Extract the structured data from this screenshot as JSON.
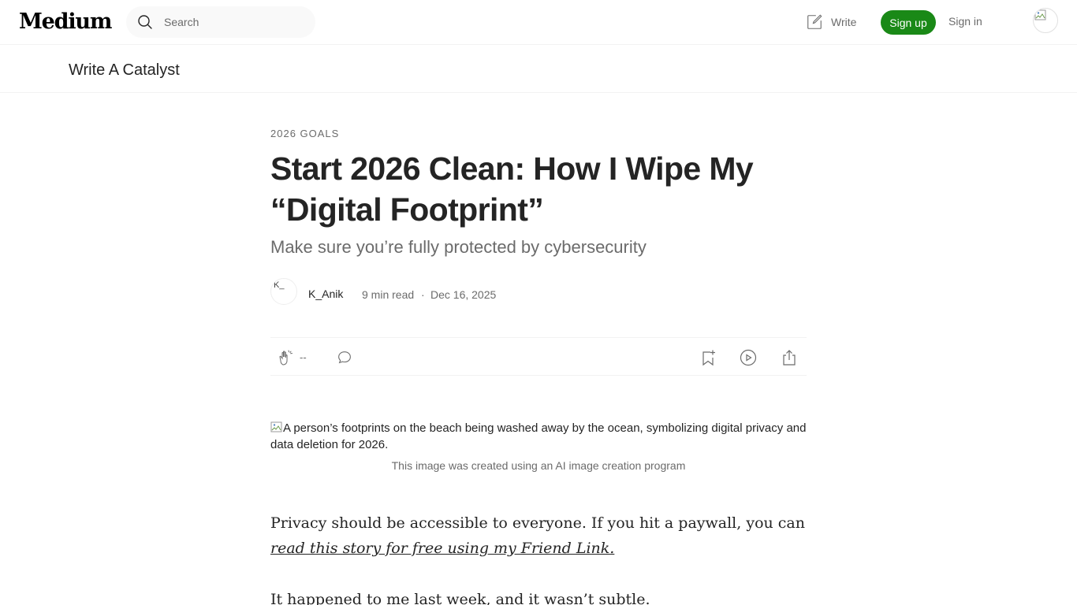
{
  "header": {
    "logo": "Medium",
    "search_placeholder": "Search",
    "write_label": "Write",
    "signup_label": "Sign up",
    "signin_label": "Sign in"
  },
  "publication": {
    "name": "Write A Catalyst"
  },
  "article": {
    "kicker": "2026 GOALS",
    "title": "Start 2026 Clean: How I Wipe My “Digital Footprint”",
    "subtitle": "Make sure you’re fully protected by cybersecurity",
    "author": {
      "name": "K_Anik",
      "avatar_alt": "K_"
    },
    "read_time": "9 min read",
    "separator": "·",
    "date": "Dec 16, 2025",
    "clap_count": "--",
    "image": {
      "alt": "A person’s footprints on the beach being washed away by the ocean, symbolizing digital privacy and data deletion for 2026.",
      "caption": "This image was created using an AI image creation program"
    },
    "paragraph_1": {
      "text": "Privacy should be accessible to everyone. If you hit a paywall, you can ",
      "link": "read this story for free using my Friend Link."
    },
    "paragraph_2": "It happened to me last week, and it wasn’t subtle."
  },
  "colors": {
    "brand_green": "#1a8917",
    "text": "#242424",
    "muted": "#6b6b6b"
  },
  "icons": [
    "search-icon",
    "write-icon",
    "clap-icon",
    "comment-icon",
    "bookmark-icon",
    "play-icon",
    "share-icon"
  ]
}
